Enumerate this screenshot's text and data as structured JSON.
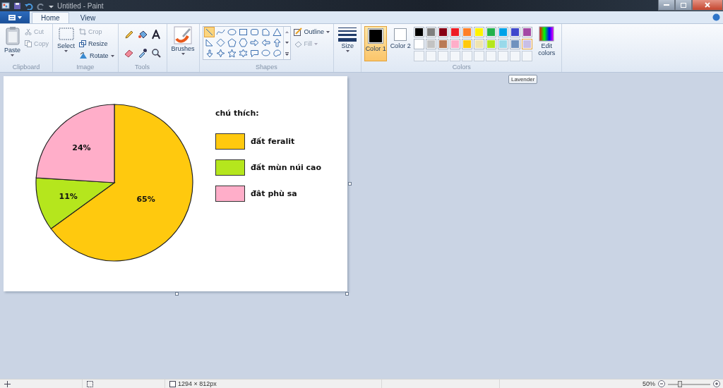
{
  "window": {
    "title": "Untitled - Paint"
  },
  "tabs": [
    {
      "label": "Home",
      "selected": true
    },
    {
      "label": "View",
      "selected": false
    }
  ],
  "ribbon": {
    "clipboard": {
      "label": "Clipboard",
      "paste": "Paste",
      "cut": {
        "label": "Cut",
        "disabled": true
      },
      "copy": {
        "label": "Copy",
        "disabled": true
      }
    },
    "image": {
      "label": "Image",
      "select": "Select",
      "crop": {
        "label": "Crop",
        "disabled": true
      },
      "resize": "Resize",
      "rotate": "Rotate"
    },
    "tools": {
      "label": "Tools"
    },
    "brushes": "Brushes",
    "shapes": {
      "label": "Shapes",
      "items": [
        {
          "selected": true
        },
        {
          "selected": false
        },
        {
          "selected": false
        },
        {
          "selected": false
        },
        {
          "selected": false
        },
        {
          "selected": false
        },
        {
          "selected": false
        },
        {
          "selected": false
        },
        {
          "selected": false
        },
        {
          "selected": false
        },
        {
          "selected": false
        },
        {
          "selected": false
        },
        {
          "selected": false
        },
        {
          "selected": false
        },
        {
          "selected": false
        },
        {
          "selected": false
        },
        {
          "selected": false
        },
        {
          "selected": false
        },
        {
          "selected": false
        },
        {
          "selected": false
        },
        {
          "selected": false
        }
      ],
      "outline": {
        "label": "Outline",
        "disabled": false
      },
      "fill": {
        "label": "Fill",
        "disabled": true
      }
    },
    "size": "Size",
    "colors": {
      "label": "Colors",
      "color1": {
        "label": "Color 1",
        "selected": true,
        "color": "#000000"
      },
      "color2": {
        "label": "Color 2",
        "selected": false,
        "color": "#ffffff"
      },
      "swatches": [
        {
          "color": "#000000",
          "hovered": false
        },
        {
          "color": "#7f7f7f",
          "hovered": false
        },
        {
          "color": "#880015",
          "hovered": false
        },
        {
          "color": "#ed1c24",
          "hovered": false
        },
        {
          "color": "#ff7f27",
          "hovered": false
        },
        {
          "color": "#fff200",
          "hovered": false
        },
        {
          "color": "#22b14c",
          "hovered": false
        },
        {
          "color": "#00a2e8",
          "hovered": false
        },
        {
          "color": "#3f48cc",
          "hovered": false
        },
        {
          "color": "#a349a4",
          "hovered": false
        },
        {
          "color": "#ffffff",
          "hovered": false
        },
        {
          "color": "#c3c3c3",
          "hovered": false
        },
        {
          "color": "#b97a57",
          "hovered": false
        },
        {
          "color": "#ffaec9",
          "hovered": false
        },
        {
          "color": "#ffc90e",
          "hovered": false
        },
        {
          "color": "#efe4b0",
          "hovered": false
        },
        {
          "color": "#b5e61d",
          "hovered": false
        },
        {
          "color": "#99d9ea",
          "hovered": false
        },
        {
          "color": "#7092be",
          "hovered": false
        },
        {
          "color": "#c8bfe7",
          "hovered": true
        }
      ],
      "edit": "Edit colors"
    }
  },
  "tooltip": "Lavender",
  "canvas": {
    "legend_title": "chú thích:",
    "chart_data": {
      "type": "pie",
      "categories": [
        "đất feralit",
        "đất mùn núi cao",
        "đât phù sa"
      ],
      "values": [
        65,
        11,
        24
      ],
      "colors": [
        "#ffc90e",
        "#b5e61d",
        "#ffaec9"
      ],
      "value_labels": [
        "65%",
        "11%",
        "24%"
      ]
    }
  },
  "status_bar": {
    "dimensions": "1294 × 812px",
    "zoom": "50%",
    "zoom_slider": {
      "level": 0.25
    }
  }
}
